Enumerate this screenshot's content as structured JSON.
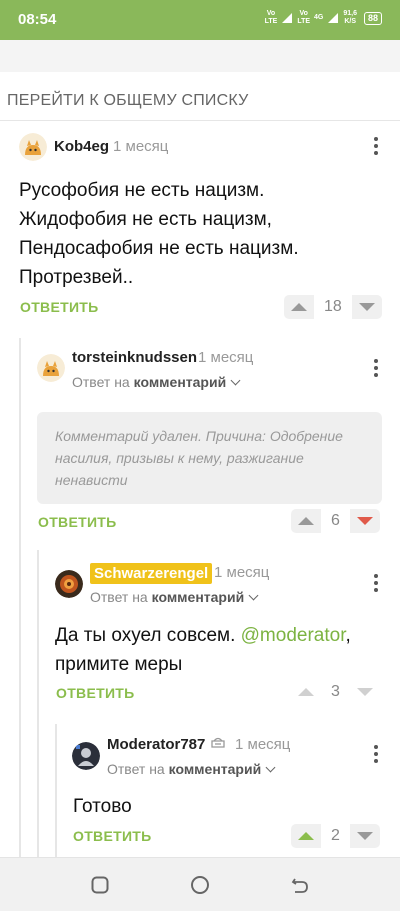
{
  "status_bar": {
    "time": "08:54",
    "net1_top": "Vo",
    "net1_bottom": "LTE",
    "net2_top": "Vo",
    "net2_bottom": "LTE",
    "net3": "4G",
    "speed_top": "91,6",
    "speed_bottom": "K/S",
    "battery": "88",
    "color": "#8ab85a"
  },
  "goto_all_label": "ПЕРЕЙТИ К ОБЩЕМУ СПИСКУ",
  "comments": [
    {
      "author": "Kob4eg",
      "date": "1 месяц",
      "text_lines": [
        "Русофобия не есть нацизм.",
        "Жидофобия не есть нацизм,",
        "Пендосафобия не есть нацизм.",
        "Протрезвей.."
      ],
      "reply_label": "ОТВЕТИТЬ",
      "votes": "18",
      "avatar_icon": "cat-avatar-icon"
    },
    {
      "author": "torsteinknudssen",
      "date": "1 месяц",
      "reply_to_prefix": "Ответ на",
      "reply_to_target": "комментарий",
      "deleted_text": "Комментарий удален. Причина: Одобрение насилия, призывы к нему, разжигание ненависти",
      "reply_label": "ОТВЕТИТЬ",
      "votes": "6",
      "avatar_icon": "cat-avatar-icon"
    },
    {
      "author": "Schwarzerengel",
      "date": "1 месяц",
      "reply_to_prefix": "Ответ на",
      "reply_to_target": "комментарий",
      "text_before": "Да ты охуел совсем. ",
      "mention": "@moderator",
      "text_after": ",",
      "text_line2": "примите меры",
      "reply_label": "ОТВЕТИТЬ",
      "votes": "3",
      "avatar_icon": "photo-avatar-icon"
    },
    {
      "author": "Moderator787",
      "date": "1 месяц",
      "reply_to_prefix": "Ответ на",
      "reply_to_target": "комментарий",
      "text": "Готово",
      "reply_label": "ОТВЕТИТЬ",
      "votes": "2",
      "avatar_icon": "moderator-avatar-icon",
      "role_icon": "moderator-badge-icon"
    }
  ],
  "colors": {
    "accent": "#8bbd4c",
    "mention": "#7cb342",
    "downvote_active": "#e05a4a",
    "badge": "#f0c21a"
  }
}
